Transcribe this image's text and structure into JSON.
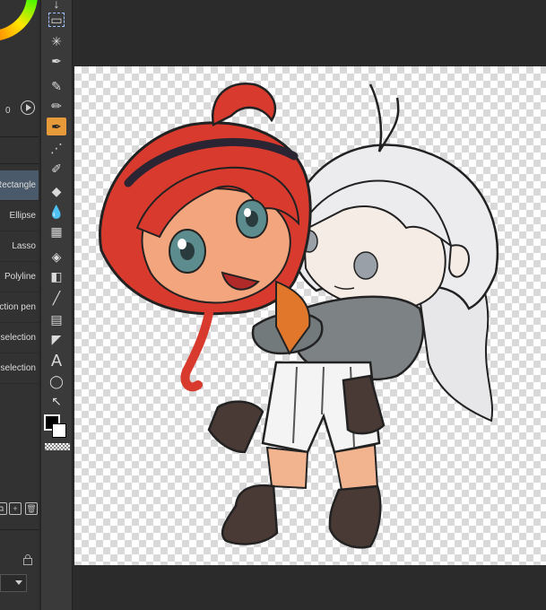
{
  "color_panel": {
    "value": "0"
  },
  "subtools": [
    {
      "label": "Rectangle",
      "selected": true
    },
    {
      "label": "Ellipse"
    },
    {
      "label": "Lasso"
    },
    {
      "label": "Polyline"
    },
    {
      "label": "Selection pen"
    },
    {
      "label": "Shrink selection"
    },
    {
      "label": "Erase selection"
    }
  ],
  "toolbar": {
    "tools": [
      "move-icon",
      "selection-icon",
      "auto-select-icon",
      "eyedropper-icon",
      "pen-icon",
      "pencil-icon",
      "brush-icon",
      "airbrush-icon",
      "decoration-icon",
      "eraser-icon",
      "blend-icon",
      "fill-icon",
      "gradient-icon",
      "figure-icon",
      "frame-icon",
      "ruler-icon",
      "text-icon",
      "balloon-icon",
      "correct-line-icon"
    ],
    "active_tool": "pen-icon",
    "main_color": "#000000",
    "sub_color": "#ffffff"
  },
  "canvas": {
    "background": "transparent"
  }
}
